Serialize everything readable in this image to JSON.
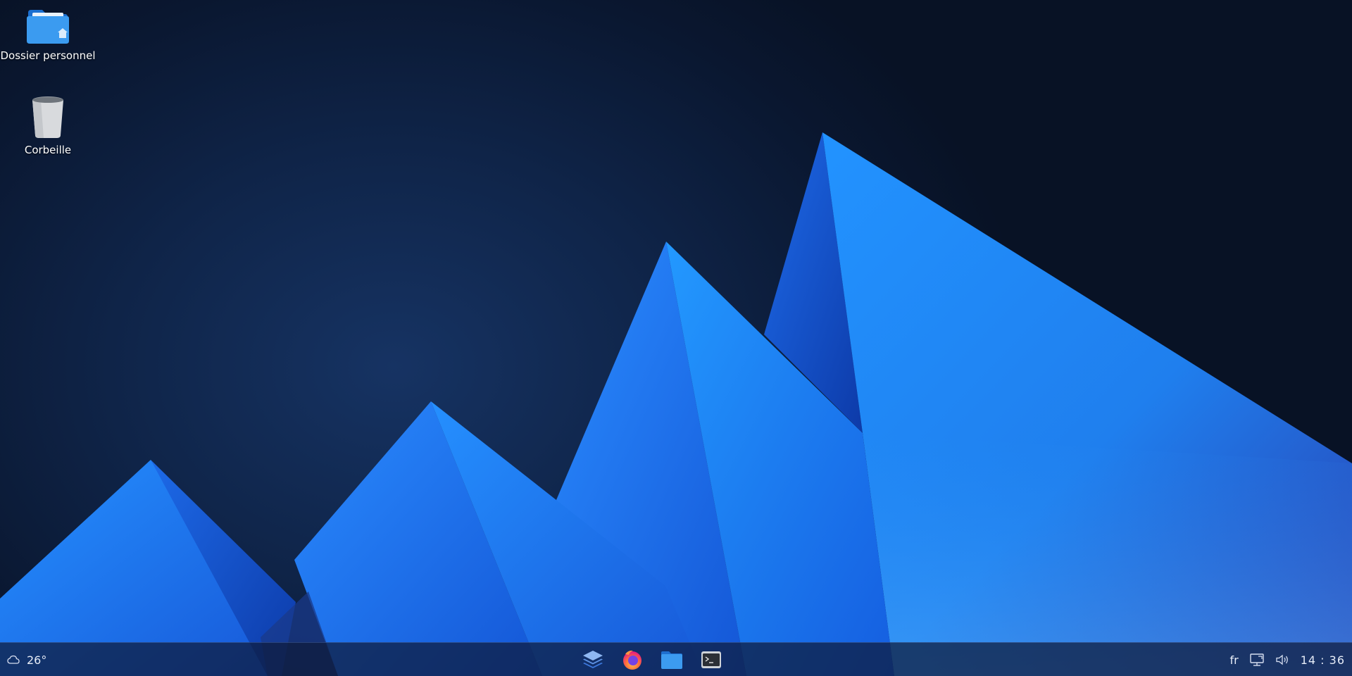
{
  "desktop_icons": [
    {
      "label": "Dossier personnel",
      "icon": "home-folder-icon"
    },
    {
      "label": "Corbeille",
      "icon": "trash-icon"
    }
  ],
  "taskbar": {
    "weather": {
      "icon": "cloud-icon",
      "temperature": "26°"
    },
    "dock": [
      {
        "name": "workspaces",
        "icon": "layers-icon"
      },
      {
        "name": "firefox",
        "icon": "firefox-icon"
      },
      {
        "name": "files",
        "icon": "folder-icon"
      },
      {
        "name": "terminal",
        "icon": "terminal-icon"
      }
    ],
    "tray": {
      "keyboard_layout": "fr",
      "network_icon": "network-icon",
      "volume_icon": "volume-icon",
      "clock": "14 : 36"
    }
  },
  "colors": {
    "background_dark": "#0a1730",
    "mountain_blue": "#1e88ff",
    "taskbar": "#0e1a3a"
  }
}
